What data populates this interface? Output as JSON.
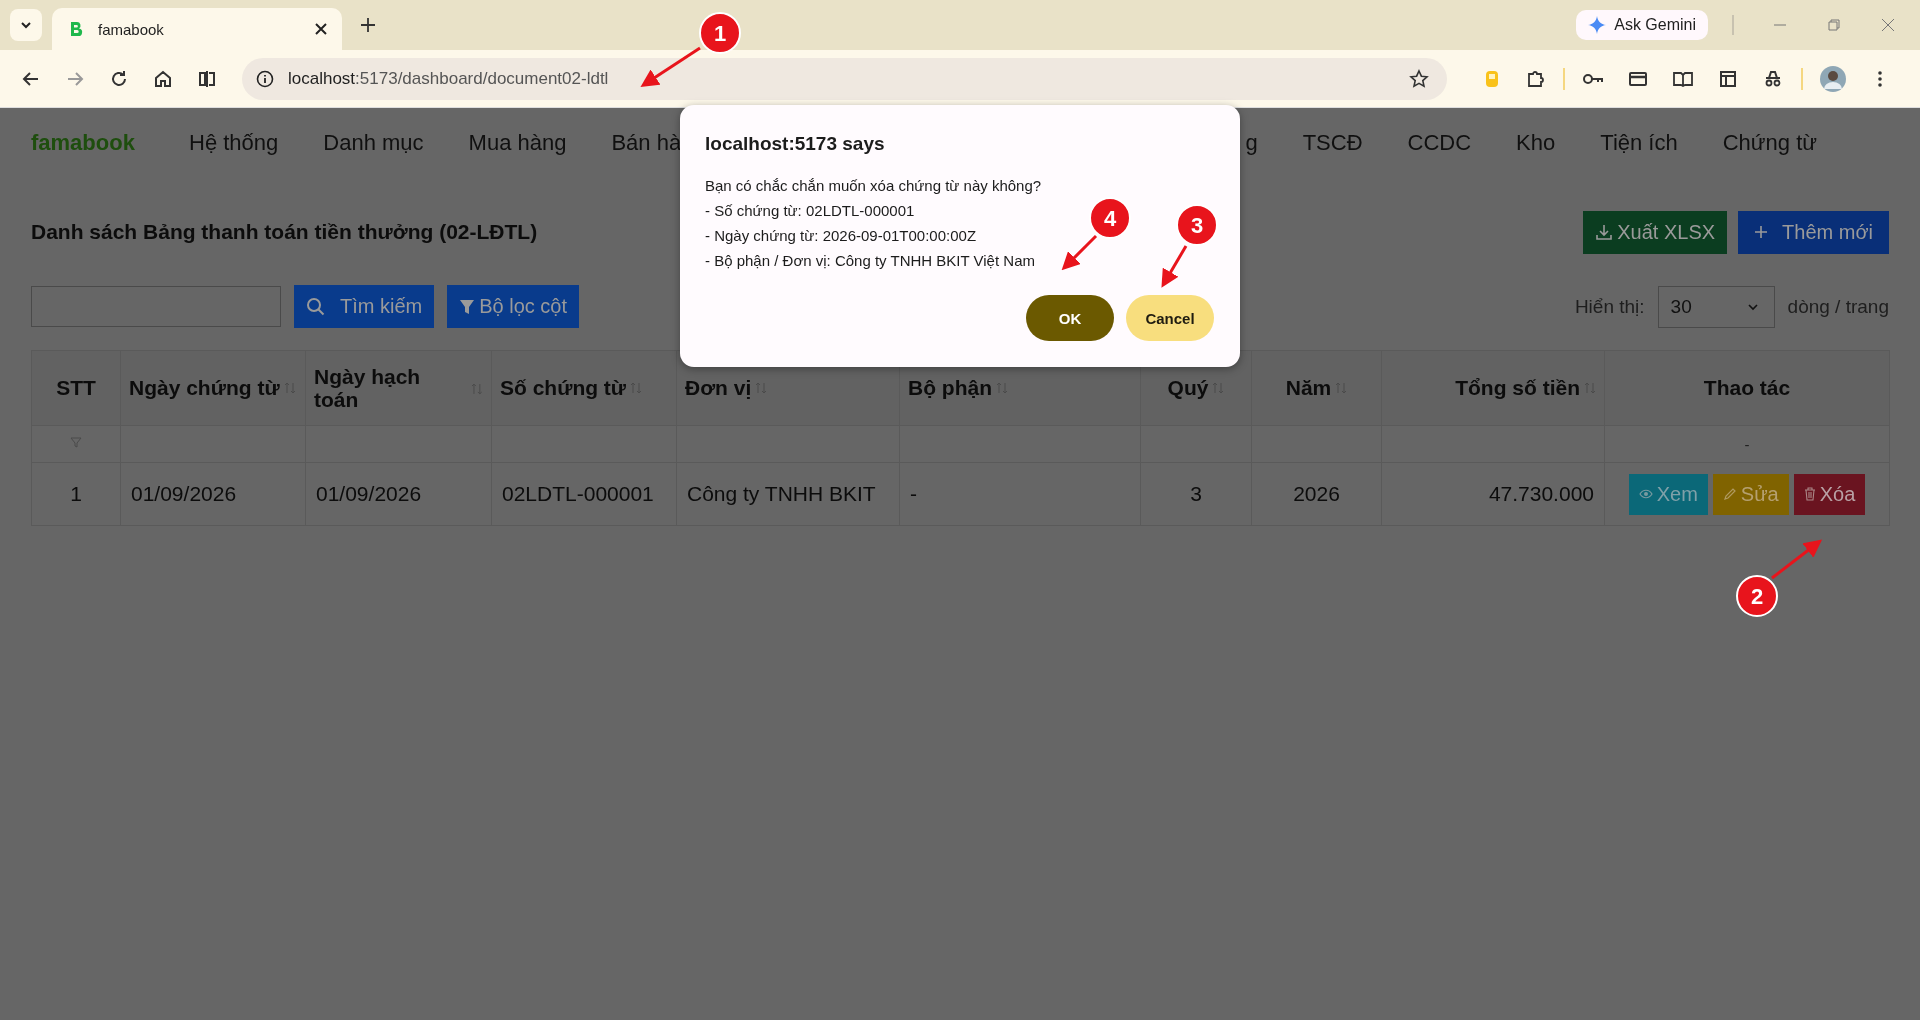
{
  "browser": {
    "tab_title": "famabook",
    "url_host": "localhost",
    "url_rest": ":5173/dashboard/document02-ldtl",
    "gemini": "Ask Gemini"
  },
  "nav": {
    "logo": "famabook",
    "items_left": [
      "Hệ thống",
      "Danh mục",
      "Mua hàng",
      "Bán hà"
    ],
    "items_right": [
      "g",
      "TSCĐ",
      "CCDC",
      "Kho",
      "Tiện ích",
      "Chứng từ"
    ]
  },
  "page": {
    "title": "Danh sách Bảng thanh toán tiền thưởng (02-LĐTL)",
    "export_button": "Xuất XLSX",
    "add_button": "Thêm mới",
    "search_button": "Tìm kiếm",
    "filter_button": "Bộ lọc cột",
    "per_page_label": "Hiển thị:",
    "per_page_value": "30",
    "per_page_suffix": "dòng / trang"
  },
  "table": {
    "columns": [
      {
        "label": "STT",
        "sortable": false
      },
      {
        "label": "Ngày chứng từ",
        "sortable": true
      },
      {
        "label": "Ngày hạch toán",
        "sortable": true
      },
      {
        "label": "Số chứng từ",
        "sortable": true
      },
      {
        "label": "Đơn vị",
        "sortable": true
      },
      {
        "label": "Bộ phận",
        "sortable": true
      },
      {
        "label": "Quý",
        "sortable": true
      },
      {
        "label": "Năm",
        "sortable": true
      },
      {
        "label": "Tổng số tiền",
        "sortable": true
      },
      {
        "label": "Thao tác",
        "sortable": false
      }
    ],
    "filter_placeholder": "-",
    "rows": [
      {
        "cells": [
          "1",
          "01/09/2026",
          "01/09/2026",
          "02LDTL-000001",
          "Công ty TNHH BKIT",
          "-",
          "3",
          "2026",
          "47.730.000"
        ],
        "actions": [
          {
            "kind": "view",
            "label": "Xem"
          },
          {
            "kind": "edit",
            "label": "Sửa"
          },
          {
            "kind": "delete",
            "label": "Xóa"
          }
        ]
      }
    ]
  },
  "dialog": {
    "title": "localhost:5173 says",
    "lines": [
      "Bạn có chắc chắn muốn xóa chứng từ này không?",
      "- Số chứng từ: 02LDTL-000001",
      "- Ngày chứng từ: 2026-09-01T00:00:00Z",
      "- Bộ phận / Đơn vị: Công ty TNHH BKIT Việt Nam"
    ],
    "buttons": [
      {
        "kind": "primary",
        "label": "OK"
      },
      {
        "kind": "secondary",
        "label": "Cancel"
      }
    ]
  },
  "annotations": [
    {
      "number": "1"
    },
    {
      "number": "2"
    },
    {
      "number": "3"
    },
    {
      "number": "4"
    }
  ]
}
